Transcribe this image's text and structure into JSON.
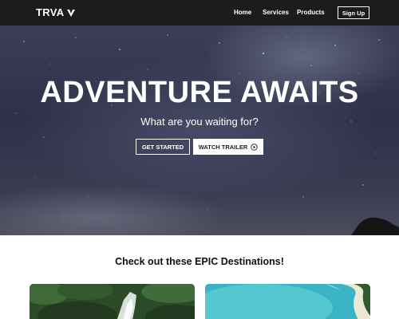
{
  "navbar": {
    "logo_text": "TRVA",
    "logo_icon": "v-chevron-icon",
    "links": [
      {
        "label": "Home"
      },
      {
        "label": "Services"
      },
      {
        "label": "Products"
      }
    ],
    "signup_label": "Sign Up"
  },
  "hero": {
    "title": "ADVENTURE AWAITS",
    "subtitle": "What are you waiting for?",
    "primary_button": "GET STARTED",
    "secondary_button": "WATCH TRAILER",
    "secondary_icon": "play-circle-icon"
  },
  "destinations": {
    "heading": "Check out these EPIC Destinations!",
    "cards": [
      {
        "image": "forest-waterfall-photo"
      },
      {
        "image": "tropical-beach-aerial-photo"
      }
    ]
  },
  "colors": {
    "navbar_bg": "#1c1c1c",
    "hero_bg": "#2e3048",
    "text_light": "#ffffff",
    "text_dark": "#111111"
  }
}
